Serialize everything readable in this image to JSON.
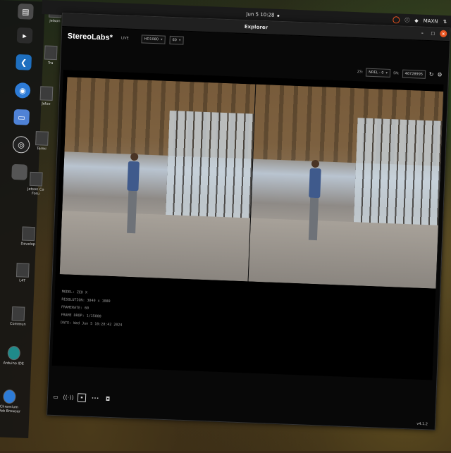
{
  "system": {
    "clock": "Jun 5  10:28",
    "user": "MAXN"
  },
  "dock": {
    "apps": [
      {
        "name": "files",
        "icon": "folder-icon",
        "color": "#4a4a4a"
      },
      {
        "name": "terminal",
        "icon": "terminal-icon",
        "color": "#2b2b2b"
      },
      {
        "name": "vscode",
        "icon": "vscode-icon",
        "color": "#1e6fbf"
      },
      {
        "name": "chromium",
        "icon": "chromium-icon",
        "color": "#2d7bd6"
      },
      {
        "name": "notes",
        "icon": "notes-icon",
        "color": "#4f82d6"
      },
      {
        "name": "obs",
        "icon": "obs-icon",
        "color": "#222222"
      },
      {
        "name": "blank",
        "icon": "blank-icon",
        "color": "#555555"
      }
    ],
    "desktop_icons": [
      {
        "label": "jetson"
      },
      {
        "label": "Tra"
      },
      {
        "label": "Jetso"
      },
      {
        "label": "Termi"
      },
      {
        "label": "Jetson Co Foru"
      },
      {
        "label": "Develop"
      },
      {
        "label": "L4T"
      },
      {
        "label": "Commun"
      },
      {
        "label": "Arduino IDE"
      },
      {
        "label": "Chromium Web Browser"
      }
    ]
  },
  "window": {
    "title": "Explorer",
    "brand": "StereoLabs*",
    "live_label": "LIVE",
    "resolution_select": "HD1080",
    "fps_select": "60",
    "zs_label": "ZS:",
    "zs_select": "NREL - 0",
    "sn_label": "SN:",
    "sn_value": "46728995",
    "overlay": {
      "model": "MODEL: ZED X",
      "resolution": "RESOLUTION: 3840 x 1080",
      "framerate": "FRAMERATE: 60",
      "frame_drop": "FRAME DROP: 1/15000",
      "date": "DATE: Wed Jun 5 10:28:42 2024"
    },
    "version": "v4.1.2"
  }
}
